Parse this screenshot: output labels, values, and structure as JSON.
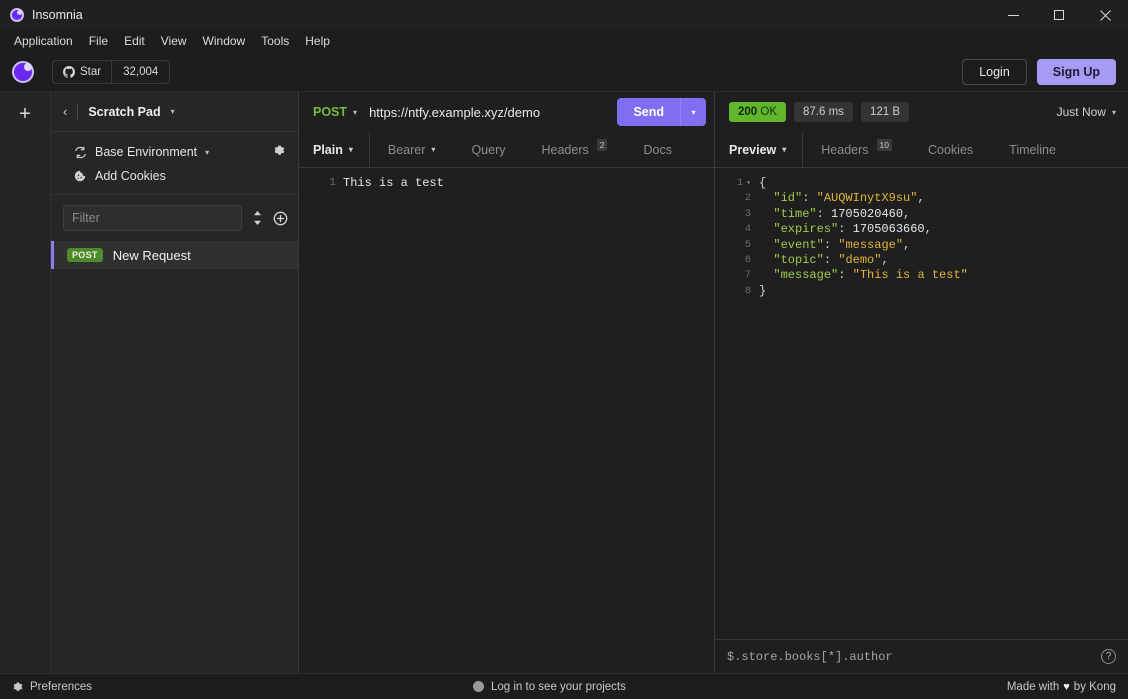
{
  "window": {
    "title": "Insomnia",
    "app_icon": "insomnia-logo-icon",
    "minimize_icon": "minimize-icon",
    "maximize_icon": "maximize-icon",
    "close_icon": "close-icon"
  },
  "menubar": {
    "items": [
      {
        "label": "Application"
      },
      {
        "label": "File"
      },
      {
        "label": "Edit"
      },
      {
        "label": "View"
      },
      {
        "label": "Window"
      },
      {
        "label": "Tools"
      },
      {
        "label": "Help"
      }
    ]
  },
  "orgbar": {
    "avatar_icon": "insomnia-avatar-icon",
    "github_icon": "github-icon",
    "star_label": "Star",
    "star_count": "32,004",
    "login_label": "Login",
    "signup_label": "Sign Up"
  },
  "rail": {
    "add_icon": "plus-icon",
    "add_label": "+"
  },
  "sidebar": {
    "back_icon": "chevron-left-icon",
    "workspace_name": "Scratch Pad",
    "workspace_caret": "▾",
    "environment": {
      "icon": "environment-swap-icon",
      "label": "Base Environment",
      "caret": "▾",
      "settings_icon": "gear-icon"
    },
    "cookies": {
      "icon": "cookie-icon",
      "label": "Add Cookies"
    },
    "filter_placeholder": "Filter",
    "filter_value": "",
    "sort_icon": "sort-icon",
    "create_icon": "plus-circle-icon",
    "requests": [
      {
        "method": "POST",
        "name": "New Request"
      }
    ]
  },
  "request": {
    "method": "POST",
    "method_caret": "▾",
    "url": "https://ntfy.example.xyz/demo",
    "send_label": "Send",
    "send_caret": "▾",
    "tabs": [
      {
        "label": "Plain",
        "caret": "▾",
        "badge": "",
        "active": true
      },
      {
        "label": "Bearer",
        "caret": "▾",
        "badge": "",
        "active": false
      },
      {
        "label": "Query",
        "caret": "",
        "badge": "",
        "active": false
      },
      {
        "label": "Headers",
        "caret": "",
        "badge": "2",
        "active": false
      },
      {
        "label": "Docs",
        "caret": "",
        "badge": "",
        "active": false
      }
    ],
    "body_lines": [
      "This is a test"
    ],
    "body_line_numbers": [
      "1"
    ]
  },
  "response": {
    "status_code": "200",
    "status_text": "OK",
    "time": "87.6 ms",
    "size": "121 B",
    "history_label": "Just Now",
    "history_caret": "▾",
    "tabs": [
      {
        "label": "Preview",
        "caret": "▾",
        "badge": "",
        "active": true
      },
      {
        "label": "Headers",
        "caret": "",
        "badge": "10",
        "active": false
      },
      {
        "label": "Cookies",
        "caret": "",
        "badge": "",
        "active": false
      },
      {
        "label": "Timeline",
        "caret": "",
        "badge": "",
        "active": false
      }
    ],
    "line_numbers": [
      "1",
      "2",
      "3",
      "4",
      "5",
      "6",
      "7",
      "8"
    ],
    "json": {
      "id": "AUQWInytX9su",
      "time": "1705020460",
      "expires": "1705063660",
      "event": "message",
      "topic": "demo",
      "message": "This is a test"
    },
    "filter_placeholder": "$.store.books[*].author",
    "filter_value": "",
    "help_icon": "question-mark-icon"
  },
  "statusbar": {
    "preferences_icon": "gear-icon",
    "preferences_label": "Preferences",
    "login_status": "Log in to see your projects",
    "status_dot_icon": "status-dot-icon",
    "made_with_prefix": "Made with",
    "heart_icon": "heart-icon",
    "made_with_suffix": "by Kong"
  },
  "colors": {
    "accent": "#7e6ff0",
    "signup": "#a59bf5",
    "success": "#62b62c",
    "method_post": "#4f8a2e",
    "json_key": "#9fcc4e",
    "json_string": "#e0b43a"
  }
}
